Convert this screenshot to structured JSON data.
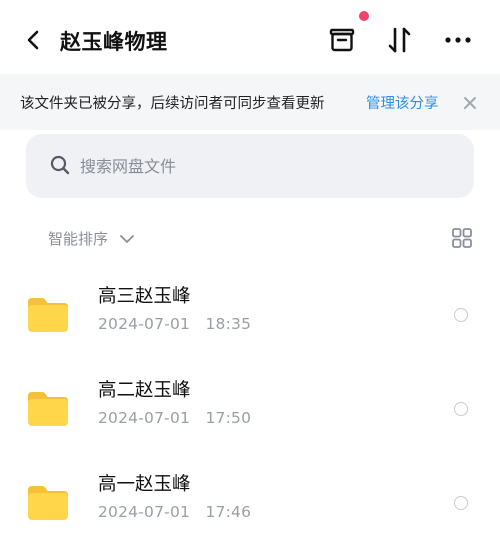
{
  "header": {
    "title": "赵玉峰物理",
    "back_icon": "chevron-left-icon",
    "archive_icon": "archive-box-icon",
    "sort_icon": "sort-arrows-icon",
    "more_icon": "more-horizontal-icon",
    "dot_color": "#f2416a"
  },
  "banner": {
    "text": "该文件夹已被分享，后续访问者可同步查看更新",
    "link": "管理该分享",
    "link_color": "#2f8ee8",
    "close_icon": "close-icon"
  },
  "search": {
    "placeholder": "搜索网盘文件",
    "value": ""
  },
  "sort": {
    "label": "智能排序",
    "chevron_icon": "chevron-down-icon",
    "view_icon": "grid-view-icon"
  },
  "files": [
    {
      "name": "高三赵玉峰",
      "time": "2024-07-01   18:35",
      "icon": "folder-icon"
    },
    {
      "name": "高二赵玉峰",
      "time": "2024-07-01   17:50",
      "icon": "folder-icon"
    },
    {
      "name": "高一赵玉峰",
      "time": "2024-07-01   17:46",
      "icon": "folder-icon"
    }
  ],
  "colors": {
    "folder_fill": "#ffd54a",
    "folder_tab": "#f5c13a",
    "accent": "#2f8ee8"
  }
}
